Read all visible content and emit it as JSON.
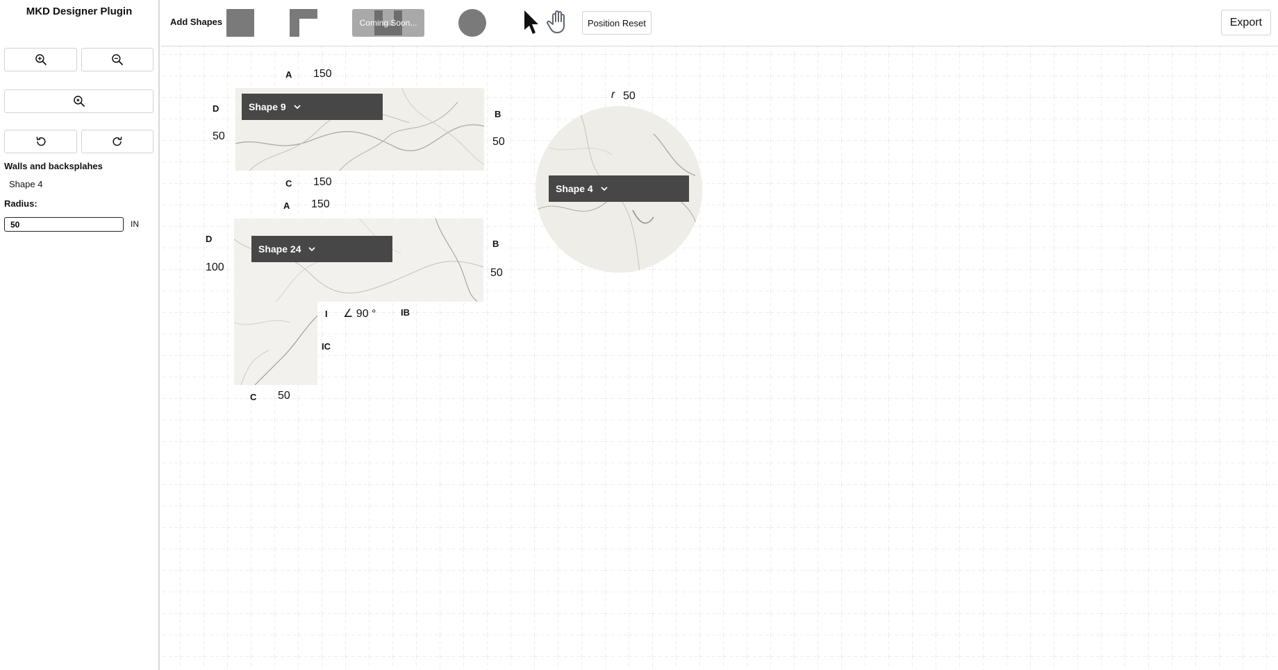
{
  "sidebar": {
    "title": "MKD Designer Plugin",
    "section_title": "Walls and backsplahes",
    "selected_shape": "Shape 4",
    "radius_label": "Radius:",
    "radius_value": "50",
    "unit": "IN"
  },
  "toolbar": {
    "add_shapes_label": "Add Shapes",
    "coming_soon_label": "Coming Soon...",
    "position_reset_label": "Position Reset",
    "export_label": "Export"
  },
  "shapes": {
    "shape9": {
      "name": "Shape 9",
      "side_a_label": "A",
      "side_a_value": "150",
      "side_b_label": "B",
      "side_b_value": "50",
      "side_c_label": "C",
      "side_c_value": "150",
      "side_d_label": "D",
      "side_d_value": "50"
    },
    "shape24": {
      "name": "Shape 24",
      "side_a_label": "A",
      "side_a_value": "150",
      "side_b_label": "B",
      "side_b_value": "50",
      "side_c_label": "C",
      "side_c_value": "50",
      "side_d_label": "D",
      "side_d_value": "100",
      "inner_i_label": "I",
      "inner_angle": "∠ 90 °",
      "inner_b_label": "IB",
      "inner_c_label": "IC"
    },
    "shape4": {
      "name": "Shape 4",
      "radius_symbol": "r",
      "radius_value": "50"
    }
  },
  "colors": {
    "dropdown_bg": "#474747",
    "shape_icon": "#7a7a7a",
    "marble_base": "#f1f0ec"
  }
}
